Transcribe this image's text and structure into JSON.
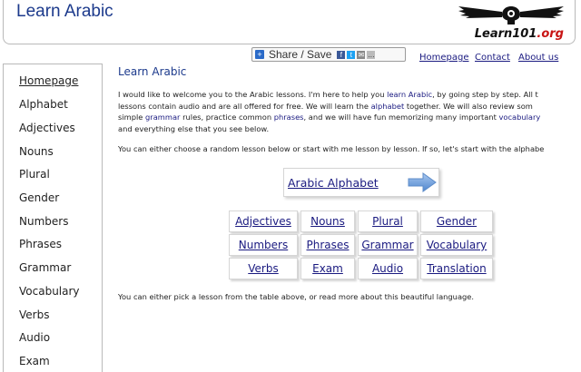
{
  "header": {
    "site_title": "Learn Arabic",
    "logo_text_black": "Learn101",
    "logo_text_red": ".org"
  },
  "share": {
    "label": "Share / Save",
    "icon": "share-plus-icon"
  },
  "top_links": [
    "Homepage",
    "Contact",
    "About us"
  ],
  "sidebar": {
    "items": [
      "Homepage",
      "Alphabet",
      "Adjectives",
      "Nouns",
      "Plural",
      "Gender",
      "Numbers",
      "Phrases",
      "Grammar",
      "Vocabulary",
      "Verbs",
      "Audio",
      "Exam"
    ]
  },
  "main": {
    "title": "Learn Arabic",
    "intro": {
      "l1a": "I would like to welcome you to the Arabic lessons. I'm here to help you ",
      "l1_link": "learn Arabic",
      "l1b": ", by going step by step. All t",
      "l2a": "lessons contain audio and are all offered for free. We will learn the ",
      "l2_link": "alphabet",
      "l2b": " together. We will also review som",
      "l3a": "simple ",
      "l3_link1": "grammar",
      "l3b": " rules, practice common ",
      "l3_link2": "phrases",
      "l3c": ", and we will have fun memorizing many important ",
      "l3_link3": "vocabulary",
      "l4": "and everything else that you see below."
    },
    "choose_text": "You can either choose a random lesson below or start with me lesson by lesson. If so, let's start with the alphabe",
    "alphabet_button": "Arabic Alphabet",
    "grid": [
      [
        "Adjectives",
        "Nouns",
        "Plural",
        "Gender"
      ],
      [
        "Numbers",
        "Phrases",
        "Grammar",
        "Vocabulary"
      ],
      [
        "Verbs",
        "Exam",
        "Audio",
        "Translation"
      ]
    ],
    "bottom_note": "You can either pick a lesson from the table above, or read more about this beautiful language."
  }
}
